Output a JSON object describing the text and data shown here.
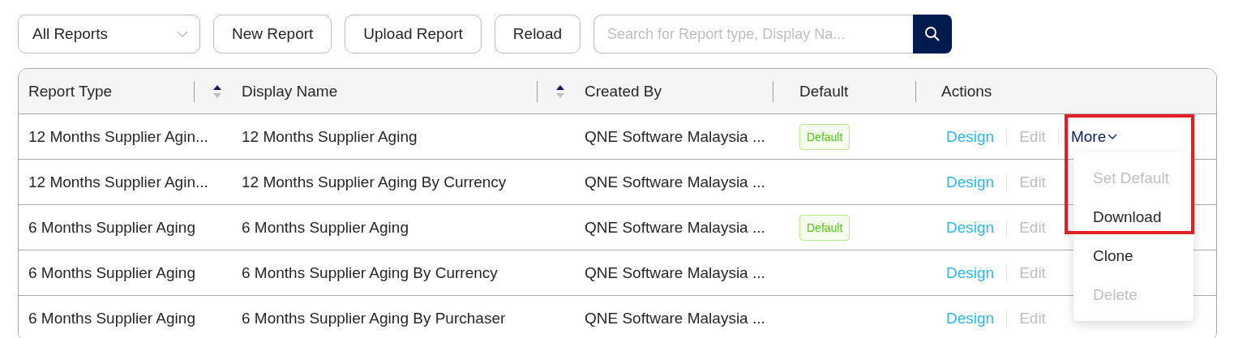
{
  "toolbar": {
    "filter": {
      "value": "All Reports"
    },
    "buttons": [
      "New Report",
      "Upload Report",
      "Reload"
    ],
    "search": {
      "placeholder": "Search for Report type, Display Na..."
    }
  },
  "table": {
    "columns": [
      {
        "label": "Report Type",
        "sortable": true
      },
      {
        "label": "Display Name",
        "sortable": true
      },
      {
        "label": "Created By",
        "sortable": false
      },
      {
        "label": "Default",
        "sortable": false
      },
      {
        "label": "Actions",
        "sortable": false
      }
    ],
    "rows": [
      {
        "report_type": "12 Months Supplier Agin...",
        "display_name": "12 Months Supplier Aging",
        "created_by": "QNE Software Malaysia ...",
        "default": true,
        "default_label": "Default",
        "design": "Design",
        "edit": "Edit",
        "more": "More",
        "expanded": true
      },
      {
        "report_type": "12 Months Supplier Agin...",
        "display_name": "12 Months Supplier Aging By Currency",
        "created_by": "QNE Software Malaysia ...",
        "default": false,
        "design": "Design",
        "edit": "Edit",
        "expanded": false
      },
      {
        "report_type": "6 Months Supplier Aging",
        "display_name": "6 Months Supplier Aging",
        "created_by": "QNE Software Malaysia ...",
        "default": true,
        "default_label": "Default",
        "design": "Design",
        "edit": "Edit",
        "expanded": false
      },
      {
        "report_type": "6 Months Supplier Aging",
        "display_name": "6 Months Supplier Aging By Currency",
        "created_by": "QNE Software Malaysia ...",
        "default": false,
        "design": "Design",
        "edit": "Edit",
        "expanded": false
      },
      {
        "report_type": "6 Months Supplier Aging",
        "display_name": "6 Months Supplier Aging By Purchaser",
        "created_by": "QNE Software Malaysia ...",
        "default": false,
        "design": "Design",
        "edit": "Edit",
        "expanded": false
      }
    ]
  },
  "more_menu": {
    "items": [
      {
        "label": "Set Default",
        "disabled": true,
        "highlighted": true
      },
      {
        "label": "Download",
        "disabled": false,
        "highlighted": true
      },
      {
        "label": "Clone",
        "disabled": false,
        "highlighted": false
      },
      {
        "label": "Delete",
        "disabled": true,
        "highlighted": false
      }
    ]
  }
}
